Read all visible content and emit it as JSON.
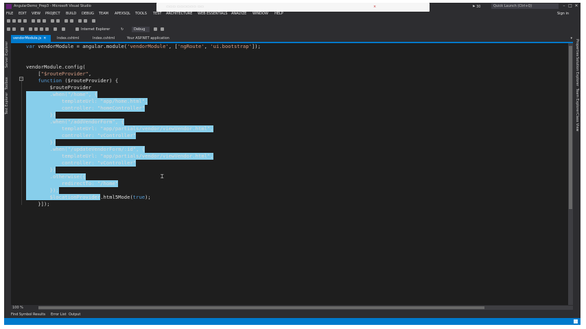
{
  "window": {
    "title": "AngularDemo_Prep3 - Microsoft Visual Studio",
    "notification_close": "×",
    "flag_count": "30",
    "quick_launch": "Quick Launch (Ctrl+Q)",
    "controls": [
      "–",
      "□",
      "✕"
    ]
  },
  "menu": [
    "FILE",
    "EDIT",
    "VIEW",
    "PROJECT",
    "BUILD",
    "DEBUG",
    "TEAM",
    "APEXSQL",
    "TOOLS",
    "TEST",
    "ARCHITECTURE",
    "WEB ESSENTIALS",
    "ANALYZE",
    "WINDOW",
    "HELP"
  ],
  "sign_in": "Sign in",
  "toolbar": {
    "browser": "Internet Explorer",
    "config": "Debug",
    "app": "Your ASP.NET application"
  },
  "left_panels": [
    "Server Explorer",
    "Toolbox",
    "Test Explorer"
  ],
  "right_panels": [
    "Properties",
    "Solution Explorer",
    "Team Explorer",
    "Class View"
  ],
  "tabs": [
    {
      "label": "vendorModule.js",
      "active": true
    },
    {
      "label": "Index.cshtml",
      "active": false
    },
    {
      "label": "Index.cshtml",
      "active": false
    },
    {
      "label": "Your ASP.NET application",
      "active": false
    }
  ],
  "code": [
    "var vendorModule = angular.module('vendorModule', ['ngRoute', 'ui.bootstrap']);",
    "",
    "",
    "vendorModule.config(",
    "    [\"$routeProvider\",",
    "    function ($routeProvider) {",
    "        $routeProvider",
    "        .when(\"/home\", {",
    "            templateUrl: \"app/home.html\",",
    "            controller: \"homeController\"",
    "        })",
    "        .when(\"/addVendorForm\", {",
    "            templateUrl: \"app/partials/vendor/viewVendor.html\",",
    "            controller: \"vController\"",
    "        })",
    "        .when(\"/updateVendorForm/:id\", {",
    "            templateUrl: \"app/partials/vendor/viewVendor.html\",",
    "            controller: \"vController\"",
    "        })",
    "        .otherwise({",
    "            redirectTo: \"/home\"",
    "        });",
    "        $locationProvider.html5Mode(true);",
    "    }]);"
  ],
  "zoom": "100 %",
  "bottom_tabs": [
    "Find Symbol Results",
    "Error List",
    "Output"
  ]
}
